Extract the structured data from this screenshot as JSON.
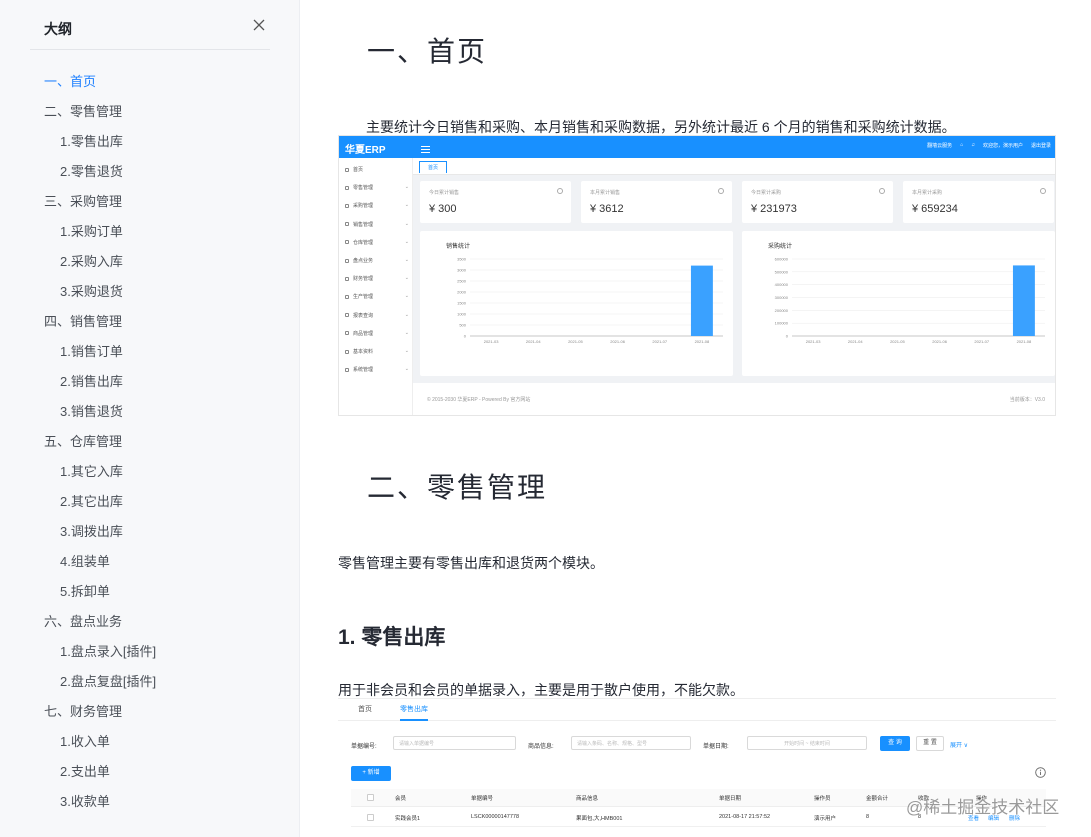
{
  "outline": {
    "title": "大纲",
    "items": [
      {
        "label": "一、首页",
        "level": 1,
        "active": true
      },
      {
        "label": "二、零售管理",
        "level": 1
      },
      {
        "label": "1.零售出库",
        "level": 2
      },
      {
        "label": "2.零售退货",
        "level": 2
      },
      {
        "label": "三、采购管理",
        "level": 1
      },
      {
        "label": "1.采购订单",
        "level": 2
      },
      {
        "label": "2.采购入库",
        "level": 2
      },
      {
        "label": "3.采购退货",
        "level": 2
      },
      {
        "label": "四、销售管理",
        "level": 1
      },
      {
        "label": "1.销售订单",
        "level": 2
      },
      {
        "label": "2.销售出库",
        "level": 2
      },
      {
        "label": "3.销售退货",
        "level": 2
      },
      {
        "label": "五、仓库管理",
        "level": 1
      },
      {
        "label": "1.其它入库",
        "level": 2
      },
      {
        "label": "2.其它出库",
        "level": 2
      },
      {
        "label": "3.调拨出库",
        "level": 2
      },
      {
        "label": "4.组装单",
        "level": 2
      },
      {
        "label": "5.拆卸单",
        "level": 2
      },
      {
        "label": "六、盘点业务",
        "level": 1
      },
      {
        "label": "1.盘点录入[插件]",
        "level": 2
      },
      {
        "label": "2.盘点复盘[插件]",
        "level": 2
      },
      {
        "label": "七、财务管理",
        "level": 1
      },
      {
        "label": "1.收入单",
        "level": 2
      },
      {
        "label": "2.支出单",
        "level": 2
      },
      {
        "label": "3.收款单",
        "level": 2
      }
    ]
  },
  "article": {
    "h1_home": "一、首页",
    "p_home": "主要统计今日销售和采购、本月销售和采购数据，另外统计最近 6 个月的销售和采购统计数据。",
    "h1_retail": "二、零售管理",
    "p_retail": "零售管理主要有零售出库和退货两个模块。",
    "h2_num": "1.",
    "h2_text": "零售出库",
    "p_outbound": "用于非会员和会员的单据录入，主要是用于散户使用，不能欠款。"
  },
  "erp_dashboard": {
    "brand": "华夏ERP",
    "topbar_right": [
      "翻墙云服务",
      "⌂",
      "♫",
      "欢迎您，演示用户",
      "退出登录"
    ],
    "tab": "首页",
    "sidebar": [
      {
        "label": "首页"
      },
      {
        "label": "零售管理"
      },
      {
        "label": "采购管理"
      },
      {
        "label": "销售管理"
      },
      {
        "label": "仓库管理"
      },
      {
        "label": "盘点业务"
      },
      {
        "label": "财务管理"
      },
      {
        "label": "生产管理"
      },
      {
        "label": "报表查询"
      },
      {
        "label": "商品管理"
      },
      {
        "label": "基本资料"
      },
      {
        "label": "系统管理"
      }
    ],
    "cards": [
      {
        "label": "今日累计销售",
        "value": "¥ 300"
      },
      {
        "label": "本月累计销售",
        "value": "¥ 3612"
      },
      {
        "label": "今日累计采购",
        "value": "¥ 231973"
      },
      {
        "label": "本月累计采购",
        "value": "¥ 659234"
      }
    ],
    "footer_left": "© 2015-2030 华夏ERP - Powered By 官方网站",
    "footer_right": "当前版本：V3.0"
  },
  "chart_data": [
    {
      "type": "bar",
      "title": "销售统计",
      "categories": [
        "2021-03",
        "2021-04",
        "2021-05",
        "2021-06",
        "2021-07",
        "2021-08"
      ],
      "values": [
        0,
        0,
        0,
        0,
        0,
        3200
      ],
      "yticks": [
        0,
        500,
        1000,
        1500,
        2000,
        2500,
        3000,
        3500
      ],
      "ylim": [
        0,
        3500
      ],
      "color": "#3aa1ff",
      "grid": true
    },
    {
      "type": "bar",
      "title": "采购统计",
      "categories": [
        "2021-03",
        "2021-04",
        "2021-05",
        "2021-06",
        "2021-07",
        "2021-08"
      ],
      "values": [
        0,
        0,
        0,
        0,
        0,
        550000
      ],
      "yticks": [
        0,
        100000,
        200000,
        300000,
        400000,
        500000,
        600000
      ],
      "ylim": [
        0,
        600000
      ],
      "color": "#3aa1ff",
      "grid": true
    }
  ],
  "retail_list": {
    "tabs": [
      "首页",
      "零售出库"
    ],
    "filters": [
      {
        "label": "单据编号:",
        "placeholder": "请输入单据编号"
      },
      {
        "label": "商品信息:",
        "placeholder": "请输入条码、名称、规格、型号"
      },
      {
        "label": "单据日期:",
        "placeholder": "开始时间  ~  结束时间"
      }
    ],
    "query_btn": "查 询",
    "reset_btn": "重 置",
    "expand_btn": "展开 ∨",
    "add_btn": "+ 新增",
    "columns": [
      "会员",
      "单据编号",
      "商品信息",
      "单据日期",
      "操作员",
      "金额合计",
      "收款",
      "操作"
    ],
    "rows": [
      {
        "member": "实践会员1",
        "number": "LSCK00000147778",
        "goods": "果面包,大,HMB001",
        "date": "2021-08-17 21:57:52",
        "operator": "演示用户",
        "amount": "8",
        "received": "8",
        "actions": [
          "查看",
          "编辑",
          "删除"
        ]
      }
    ]
  },
  "watermark": "@稀土掘金技术社区",
  "accent_color": "#1e80ff"
}
